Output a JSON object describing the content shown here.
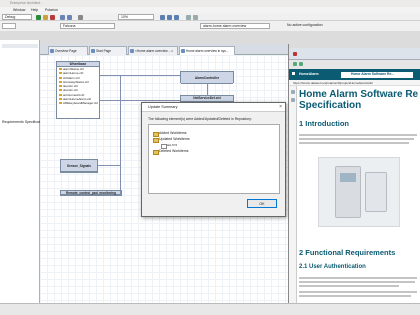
{
  "window": {
    "title": "Enterprise Architect"
  },
  "menu": [
    "Window",
    "Help",
    "Polarion"
  ],
  "toolbar": {
    "mode": "Debug",
    "zoom": "10%",
    "language": "Falcona",
    "search": "alarm-home alarm overview",
    "config": "No active configuration"
  },
  "tree": {
    "label": "Requirements Specification"
  },
  "tabs": [
    "Overview Page",
    "Start Page",
    "<Home alarm overview ...>",
    "Home alarm overview in sys..."
  ],
  "diagram": {
    "components": [
      {
        "title": "Wheelbase",
        "rows": [
          "alarmStatus.ctrl",
          "alarmHome.ctrl",
          "ctrlAlarm.ctrl",
          "armAwayStatus.ctrl",
          "doorsIn.ctrl",
          "doorsIn.ctrl",
          "armHomeAll.ctrl",
          "alarmHomeAlarm.ctrl",
          "ADEkeyboardManager.ctrl"
        ]
      },
      {
        "title": "AlarmController",
        "rows": []
      },
      {
        "title": "NetServiceDef.ctrl",
        "rows": []
      },
      {
        "title": "Sensor_Signals",
        "rows": []
      },
      {
        "title": "Remote_control_pad_monitoring",
        "rows": []
      }
    ]
  },
  "dialog": {
    "title": "Update Summary",
    "message": "The following element(s) were Added/Updated/Deleted in Repository:",
    "nodes": [
      "Added Workitems",
      "Updated Workitems",
      "HA-572",
      "Deleted Workitems"
    ],
    "ok": "OK"
  },
  "browser": {
    "nav": "HomeAlarm",
    "page_tab": "Home Alarm Software Re...",
    "url": "https://bmcle.dataset.net/polarion/#/project/HomeAlarm/wiki/",
    "h1a": "Home Alarm Software Re",
    "h1b": "Specification",
    "sec1": "1 Introduction",
    "sec2": "2 Functional Requirements",
    "sec21": "2.1 User Authentication"
  },
  "colors": {
    "teal": "#0b5b73",
    "dialog_border": "#0078d7"
  }
}
